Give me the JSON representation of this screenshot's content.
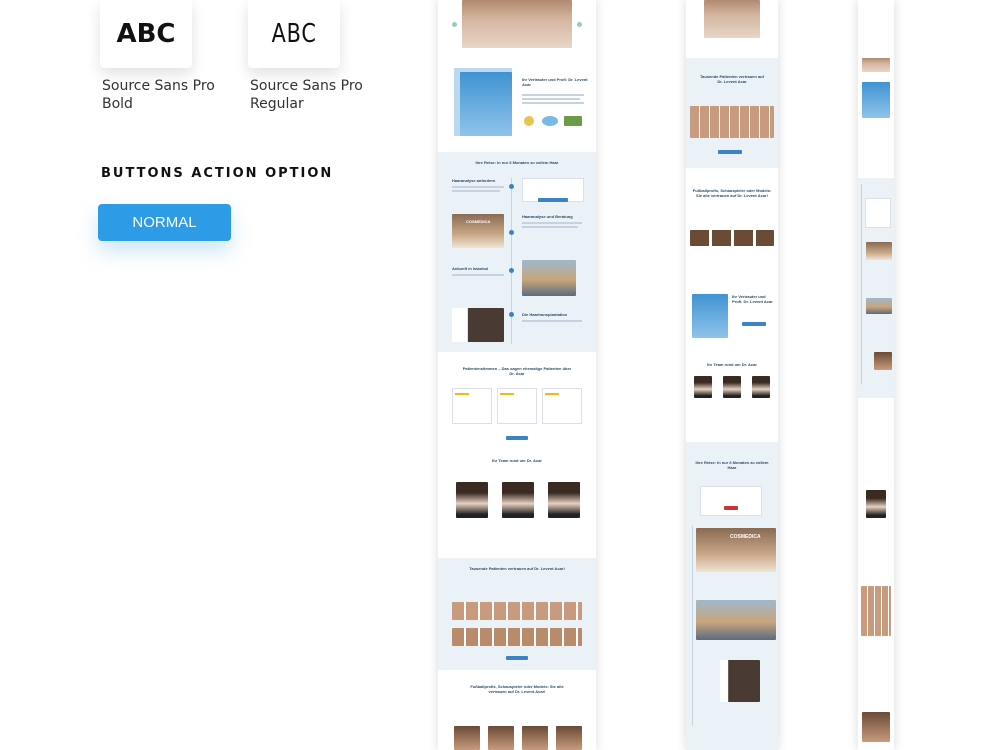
{
  "fonts": {
    "bold_sample": "ABC",
    "bold_name": "Source Sans Pro Bold",
    "regular_sample": "ABC",
    "regular_name": "Source Sans Pro Regular"
  },
  "buttons": {
    "section_title": "BUTTONS ACTION OPTION",
    "normal_label": "NORMAL"
  },
  "mockup_desktop": {
    "doctor_heading": "Ihr Vertrauter und Profi: Dr. Levent Acar",
    "journey_heading": "Ihre Reise: In nur 6 Monaten zu vollem Haar",
    "step1": "Haaranalyse anfordern",
    "step2": "Haaranalyse und Beratung",
    "step3": "Ankunft in Istanbul",
    "step4": "Die Haartransplantation",
    "office_sign": "COSMEDICA",
    "testimonials_heading": "Patientenstimmen – Das sagen ehemalige Patienten über Dr. Acar",
    "team_heading": "Ihr Team rund um Dr. Acar",
    "trust_heading": "Tausende Patienten vertrauen auf Dr. Levent Acar!",
    "celebs_heading": "Fußballprofis, Schauspieler oder Models: Sie alle vertrauen auf Dr. Levent Acar!"
  },
  "mockup_tablet": {
    "trust_heading": "Tausende Patienten vertrauen auf Dr. Levent Acar",
    "celebs_heading": "Fußballprofis, Schauspieler oder Models: Sie alle vertrauen auf Dr. Levent Acar!",
    "doctor_heading": "Ihr Vertrauter und Profi: Dr. Levent Acar",
    "team_heading": "Ihr Team rund um Dr. Acar",
    "journey_heading": "Ihre Reise: In nur 6 Monaten zu vollem Haar",
    "office_sign": "COSMEDICA"
  },
  "colors": {
    "button": "#2e9be6",
    "accent": "#3b83c4",
    "section_bg": "#eaf2f8"
  }
}
